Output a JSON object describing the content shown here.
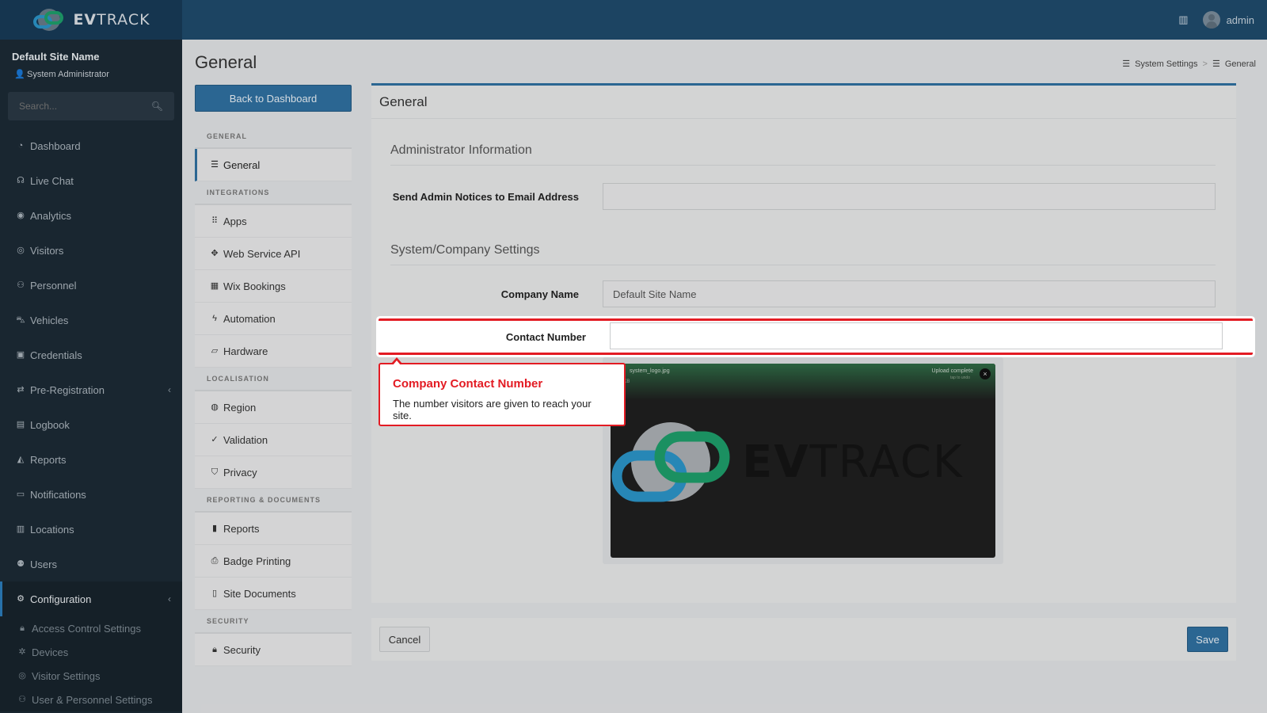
{
  "brand": {
    "name_bold": "EV",
    "name_light": "TRACK"
  },
  "header": {
    "user_name": "admin"
  },
  "sidebar": {
    "site_name": "Default Site Name",
    "role": "System Administrator",
    "search_placeholder": "Search...",
    "items": [
      {
        "label": "Dashboard"
      },
      {
        "label": "Live Chat"
      },
      {
        "label": "Analytics"
      },
      {
        "label": "Visitors"
      },
      {
        "label": "Personnel"
      },
      {
        "label": "Vehicles"
      },
      {
        "label": "Credentials"
      },
      {
        "label": "Pre-Registration"
      },
      {
        "label": "Logbook"
      },
      {
        "label": "Reports"
      },
      {
        "label": "Notifications"
      },
      {
        "label": "Locations"
      },
      {
        "label": "Users"
      },
      {
        "label": "Configuration"
      }
    ],
    "sub_items": [
      {
        "label": "Access Control Settings"
      },
      {
        "label": "Devices"
      },
      {
        "label": "Visitor Settings"
      },
      {
        "label": "User & Personnel Settings"
      }
    ]
  },
  "page": {
    "title": "General"
  },
  "breadcrumb": {
    "parent": "System Settings",
    "current": "General"
  },
  "settings_nav": {
    "back_label": "Back to Dashboard",
    "groups": [
      {
        "heading": "GENERAL",
        "items": [
          {
            "label": "General"
          }
        ]
      },
      {
        "heading": "INTEGRATIONS",
        "items": [
          {
            "label": "Apps"
          },
          {
            "label": "Web Service API"
          },
          {
            "label": "Wix Bookings"
          },
          {
            "label": "Automation"
          },
          {
            "label": "Hardware"
          }
        ]
      },
      {
        "heading": "LOCALISATION",
        "items": [
          {
            "label": "Region"
          },
          {
            "label": "Validation"
          },
          {
            "label": "Privacy"
          }
        ]
      },
      {
        "heading": "REPORTING & DOCUMENTS",
        "items": [
          {
            "label": "Reports"
          },
          {
            "label": "Badge Printing"
          },
          {
            "label": "Site Documents"
          }
        ]
      },
      {
        "heading": "SECURITY",
        "items": [
          {
            "label": "Security"
          }
        ]
      }
    ]
  },
  "card": {
    "title": "General",
    "admin_section": "Administrator Information",
    "admin_email_label": "Send Admin Notices to Email Address",
    "admin_email_value": "",
    "company_section": "System/Company Settings",
    "company_name_label": "Company Name",
    "company_name_value": "Default Site Name",
    "contact_label": "Contact Number",
    "contact_value": ""
  },
  "upload": {
    "file_name": "system_logo.jpg",
    "file_size": "10 KB",
    "status": "Upload complete",
    "hint": "tap to undo",
    "logo_bold": "EV",
    "logo_light": "TRACK"
  },
  "footer": {
    "cancel_label": "Cancel",
    "save_label": "Save"
  },
  "tooltip": {
    "title": "Company Contact Number",
    "body": "The number visitors are given to reach your site."
  },
  "colors": {
    "accent": "#2f6f9f",
    "highlight": "#e31b23",
    "sidebar": "#1c2a35",
    "topbar": "#1f4a6b",
    "logo_blue": "#2b93c6",
    "logo_green": "#1e9d6a"
  }
}
